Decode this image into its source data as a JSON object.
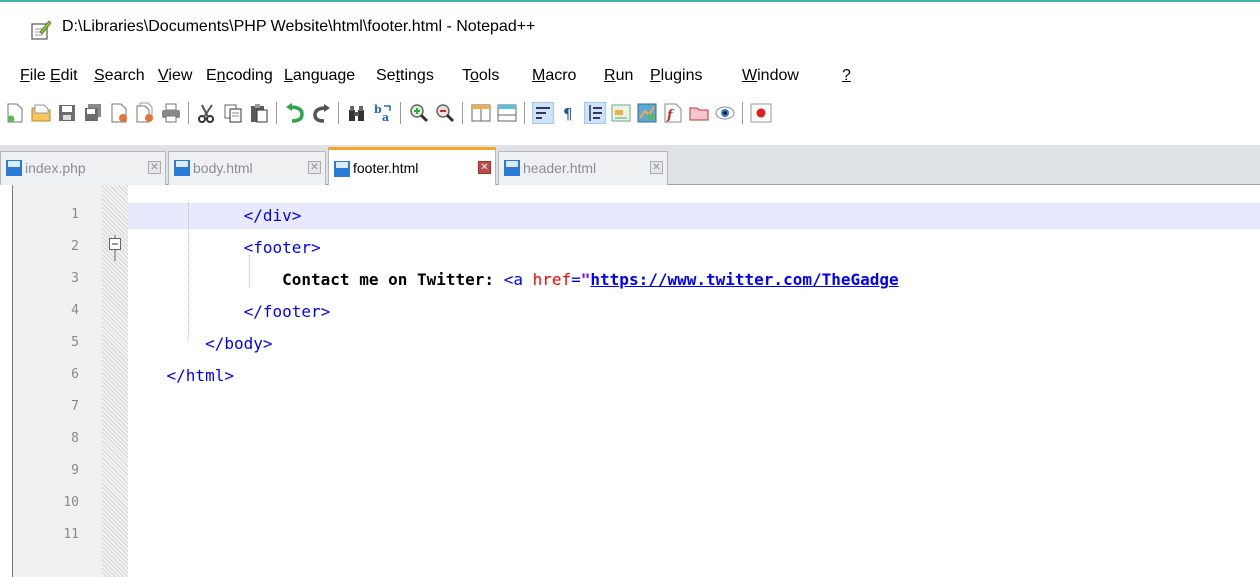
{
  "window": {
    "title": "D:\\Libraries\\Documents\\PHP Website\\html\\footer.html - Notepad++"
  },
  "menu": [
    {
      "ul": "F",
      "rest": "ile"
    },
    {
      "ul": "E",
      "rest": "dit"
    },
    {
      "ul": "S",
      "rest": "earch"
    },
    {
      "ul": "V",
      "rest": "iew"
    },
    {
      "pre": "E",
      "ul": "n",
      "rest": "coding"
    },
    {
      "ul": "L",
      "rest": "anguage"
    },
    {
      "pre": "Se",
      "ul": "t",
      "rest": "tings"
    },
    {
      "pre": "T",
      "ul": "o",
      "rest": "ols"
    },
    {
      "ul": "M",
      "rest": "acro"
    },
    {
      "ul": "R",
      "rest": "un"
    },
    {
      "ul": "P",
      "rest": "lugins"
    },
    {
      "ul": "W",
      "rest": "indow"
    },
    {
      "ul": "?",
      "rest": ""
    }
  ],
  "toolbar": {
    "icons": [
      "new-file-icon",
      "open-file-icon",
      "save-icon",
      "save-all-icon",
      "close-icon",
      "close-all-icon",
      "print-icon",
      "cut-icon",
      "copy-icon",
      "paste-icon",
      "undo-icon",
      "redo-icon",
      "find-icon",
      "replace-icon",
      "zoom-in-icon",
      "zoom-out-icon",
      "sync-vertical-icon",
      "sync-horizontal-icon",
      "word-wrap-icon",
      "show-all-chars-icon",
      "indent-guide-icon",
      "user-language-icon",
      "document-map-icon",
      "function-list-icon",
      "folder-as-workspace-icon",
      "monitoring-icon",
      "record-macro-icon"
    ]
  },
  "tabs": [
    {
      "label": "index.php",
      "active": false
    },
    {
      "label": "body.html",
      "active": false
    },
    {
      "label": "footer.html",
      "active": true
    },
    {
      "label": "header.html",
      "active": false
    }
  ],
  "editor": {
    "line_numbers": [
      "1",
      "2",
      "3",
      "4",
      "5",
      "6",
      "7",
      "8",
      "9",
      "10",
      "11"
    ],
    "current_line": 1,
    "code": [
      {
        "indent": "            ",
        "tokens": [
          [
            "tag",
            "</div>"
          ]
        ]
      },
      {
        "indent": "            ",
        "tokens": [
          [
            "tag",
            "<footer>"
          ]
        ]
      },
      {
        "indent": "                ",
        "tokens": [
          [
            "plain",
            "Contact me on Twitter: "
          ],
          [
            "tag",
            "<a "
          ],
          [
            "attr",
            "href"
          ],
          [
            "tag",
            "="
          ],
          [
            "str",
            "\""
          ],
          [
            "url",
            "https://www.twitter.com/TheGadge"
          ]
        ]
      },
      {
        "indent": "            ",
        "tokens": [
          [
            "tag",
            "</footer>"
          ]
        ]
      },
      {
        "indent": "        ",
        "tokens": [
          [
            "tag",
            "</body>"
          ]
        ]
      },
      {
        "indent": "    ",
        "tokens": [
          [
            "tag",
            "</html>"
          ]
        ]
      }
    ]
  },
  "colors": {
    "accent_tab": "#f5a623",
    "tag": "#0000ff",
    "attribute": "#ff0000",
    "string": "#8000ff",
    "current_line": "#e8e8ff"
  }
}
